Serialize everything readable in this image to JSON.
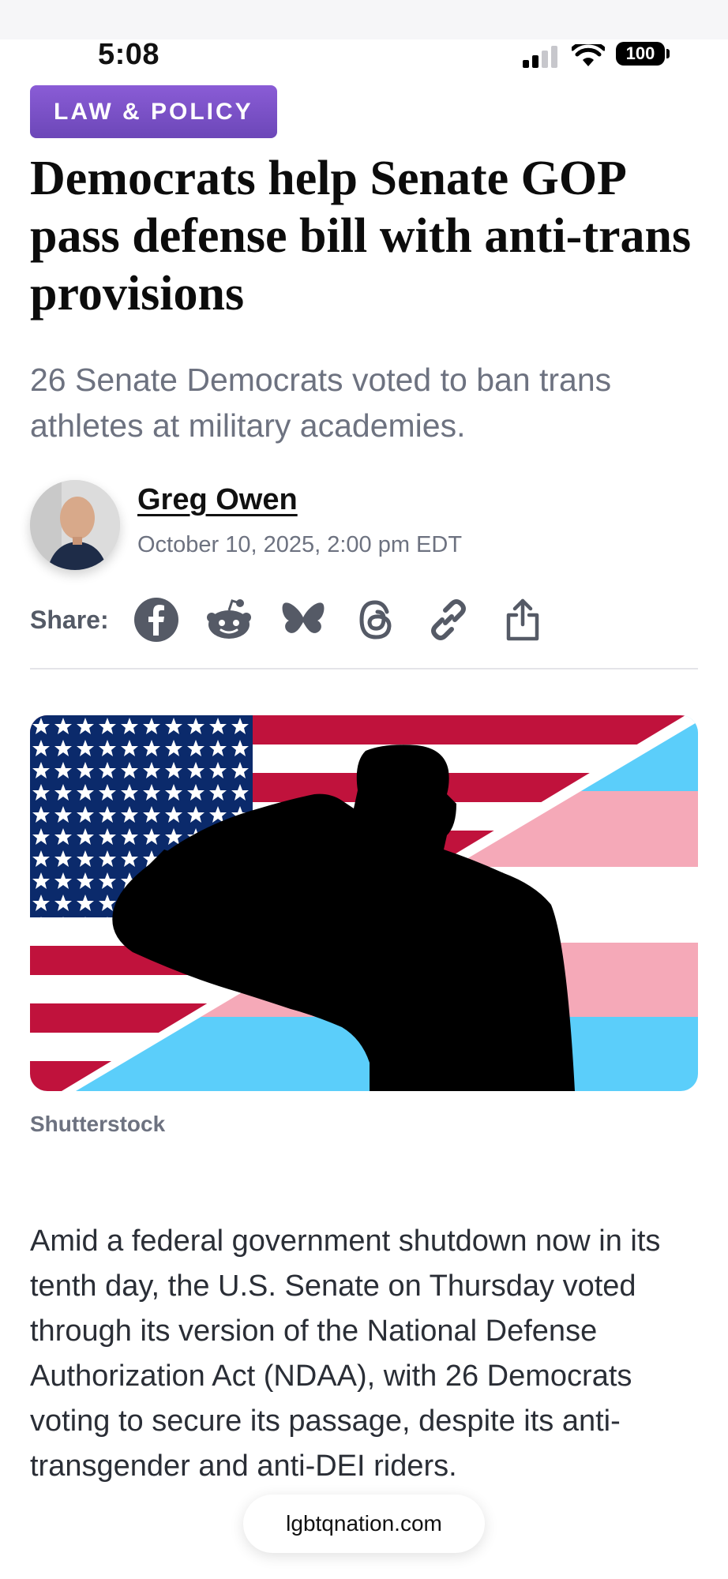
{
  "status_bar": {
    "time": "5:08",
    "battery": "100"
  },
  "article": {
    "category": "LAW & POLICY",
    "headline": "Democrats help Senate GOP pass defense bill with anti-trans provisions",
    "dek": "26 Senate Democrats voted to ban trans athletes at military academies.",
    "author": "Greg Owen",
    "date": "October 10, 2025, 2:00 pm EDT",
    "share_label": "Share:",
    "share_icons": [
      "facebook-icon",
      "reddit-icon",
      "bluesky-icon",
      "threads-icon",
      "link-icon",
      "share-icon"
    ],
    "image_credit": "Shutterstock",
    "body": "Amid a federal government shutdown now in its tenth day, the U.S. Senate on Thursday voted through its version of the National Defense Authorization Act (NDAA), with 26 Democrats voting to secure its passage, despite its anti-transgender and anti-DEI riders."
  },
  "url_pill": {
    "domain": "lgbtqnation.com"
  },
  "colors": {
    "badge": "#7a52c8",
    "flag_red": "#c0123c",
    "flag_blue": "#0b2a6b",
    "trans_blue": "#5bcefa",
    "trans_pink": "#f5a9b8"
  }
}
